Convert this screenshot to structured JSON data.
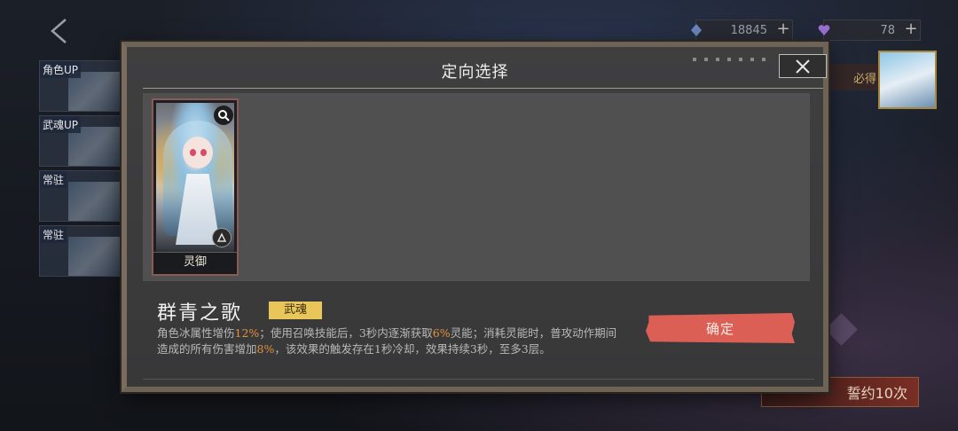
{
  "hud": {
    "resource_a": {
      "value": "18845",
      "plus": "+",
      "icon": "crystal-icon"
    },
    "resource_b": {
      "value": "78",
      "plus": "+",
      "icon": "heart-gem-icon"
    },
    "side_tabs": [
      "角色UP",
      "武魂UP",
      "常驻",
      "常驻"
    ],
    "guarantee_label": "必得",
    "contract_button": "誓约10次"
  },
  "modal": {
    "title": "定向选择",
    "card": {
      "label": "灵御"
    },
    "item": {
      "name": "群青之歌",
      "tag": "武魂",
      "desc": {
        "p1": "角色冰属性增伤",
        "v1": "12%",
        "p2": "；使用召唤技能后，3秒内逐渐获取",
        "v2": "6%",
        "p3": "灵能；消耗灵能时，普攻动作期间造成的所有伤害增加",
        "v3": "8%",
        "p4": "，该效果的触发存在1秒冷却，效果持续3秒，至多3层。"
      }
    },
    "confirm_label": "确定"
  },
  "colors": {
    "confirm": "#dc5f55",
    "tag": "#e8c65a",
    "highlight": "#e2903e",
    "frame": "#6f6356"
  }
}
